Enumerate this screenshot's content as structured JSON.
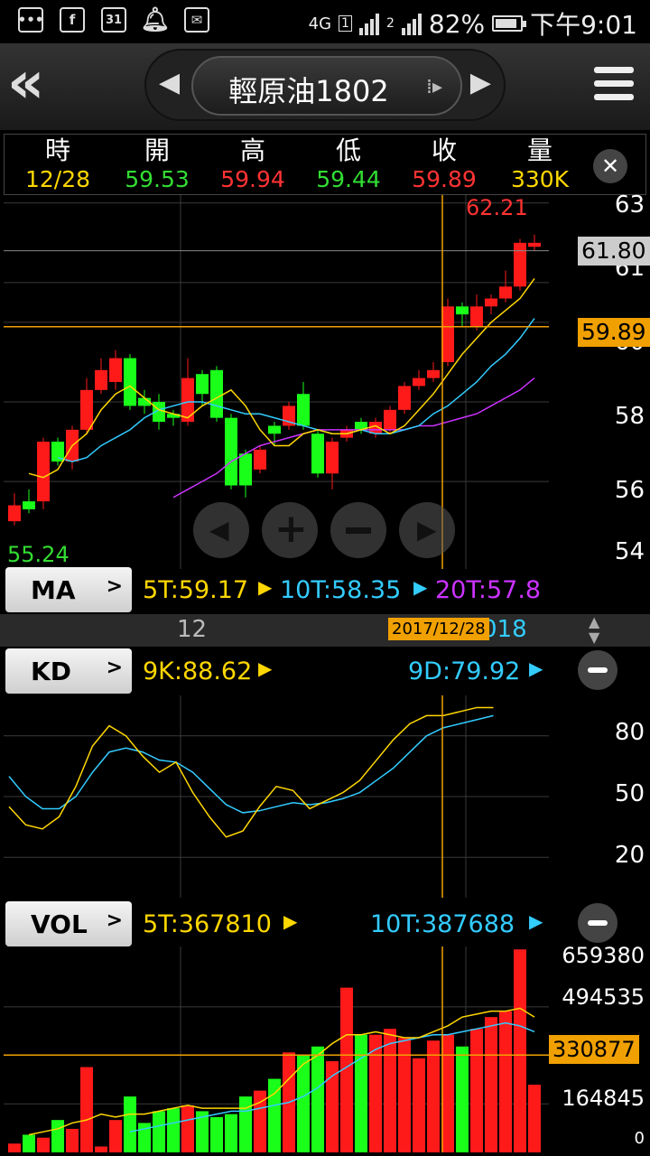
{
  "status": {
    "network": "4G",
    "sim1": "1",
    "sim2": "2",
    "battery": "82%",
    "battery_level": 0.82,
    "time": "下午9:01"
  },
  "header": {
    "title": "輕原油1802"
  },
  "quote": {
    "headers": [
      "時",
      "開",
      "高",
      "低",
      "收",
      "量"
    ],
    "values": [
      "12/28",
      "59.53",
      "59.94",
      "59.44",
      "59.89",
      "330K"
    ],
    "colors": [
      "#ffd700",
      "#33dd33",
      "#ff3333",
      "#33dd33",
      "#ff3333",
      "#ffd700"
    ]
  },
  "price_chart": {
    "y_ticks": [
      "63",
      "61",
      "60",
      "58",
      "56",
      "54"
    ],
    "high_label": "62.21",
    "low_label": "55.24",
    "last_tag": "61.80",
    "cursor_tag": "59.89"
  },
  "ma": {
    "button": "MA",
    "ma5": "5T:59.17",
    "ma10": "10T:58.35",
    "ma20": "20T:57.8"
  },
  "date_axis": {
    "label_month": "12",
    "label_year": "018",
    "cursor_date": "2017/12/28"
  },
  "kd": {
    "button": "KD",
    "k": "9K:88.62",
    "d": "9D:79.92",
    "y_ticks": [
      "80",
      "50",
      "20"
    ]
  },
  "vol": {
    "button": "VOL",
    "v5": "5T:367810",
    "v10": "10T:387688",
    "y_ticks": [
      "659380",
      "494535",
      "164845",
      "0"
    ],
    "cursor_tag": "330877"
  },
  "chart_data": {
    "type": "candlestick",
    "candles": [
      {
        "o": 55.0,
        "c": 55.4,
        "h": 55.7,
        "l": 54.9
      },
      {
        "o": 55.5,
        "c": 55.3,
        "h": 55.8,
        "l": 55.2
      },
      {
        "o": 55.5,
        "c": 57.0,
        "h": 57.1,
        "l": 55.3
      },
      {
        "o": 57.0,
        "c": 56.5,
        "h": 57.1,
        "l": 56.4
      },
      {
        "o": 56.5,
        "c": 57.3,
        "h": 57.4,
        "l": 56.3
      },
      {
        "o": 57.3,
        "c": 58.3,
        "h": 58.6,
        "l": 57.2
      },
      {
        "o": 58.3,
        "c": 58.8,
        "h": 59.1,
        "l": 58.2
      },
      {
        "o": 58.5,
        "c": 59.1,
        "h": 59.3,
        "l": 58.3
      },
      {
        "o": 59.1,
        "c": 57.9,
        "h": 59.2,
        "l": 57.8
      },
      {
        "o": 58.1,
        "c": 57.9,
        "h": 58.3,
        "l": 57.7
      },
      {
        "o": 58.0,
        "c": 57.5,
        "h": 58.2,
        "l": 57.3
      },
      {
        "o": 57.7,
        "c": 57.6,
        "h": 57.8,
        "l": 57.4
      },
      {
        "o": 57.5,
        "c": 58.6,
        "h": 59.1,
        "l": 57.4
      },
      {
        "o": 58.7,
        "c": 58.2,
        "h": 58.8,
        "l": 57.9
      },
      {
        "o": 58.8,
        "c": 57.6,
        "h": 58.9,
        "l": 57.5
      },
      {
        "o": 57.6,
        "c": 55.9,
        "h": 57.7,
        "l": 55.8
      },
      {
        "o": 56.7,
        "c": 55.9,
        "h": 56.8,
        "l": 55.6
      },
      {
        "o": 56.3,
        "c": 56.8,
        "h": 56.9,
        "l": 56.2
      },
      {
        "o": 57.4,
        "c": 57.2,
        "h": 57.5,
        "l": 56.9
      },
      {
        "o": 57.4,
        "c": 57.9,
        "h": 58.0,
        "l": 57.3
      },
      {
        "o": 58.2,
        "c": 57.4,
        "h": 58.5,
        "l": 57.3
      },
      {
        "o": 57.2,
        "c": 56.2,
        "h": 57.3,
        "l": 56.1
      },
      {
        "o": 56.2,
        "c": 57.0,
        "h": 57.1,
        "l": 55.8
      },
      {
        "o": 57.1,
        "c": 57.3,
        "h": 57.4,
        "l": 57.0
      },
      {
        "o": 57.5,
        "c": 57.3,
        "h": 57.6,
        "l": 57.2
      },
      {
        "o": 57.2,
        "c": 57.5,
        "h": 57.6,
        "l": 57.1
      },
      {
        "o": 57.3,
        "c": 57.8,
        "h": 57.9,
        "l": 57.2
      },
      {
        "o": 57.8,
        "c": 58.4,
        "h": 58.5,
        "l": 57.7
      },
      {
        "o": 58.4,
        "c": 58.6,
        "h": 58.8,
        "l": 58.3
      },
      {
        "o": 58.6,
        "c": 58.8,
        "h": 59.0,
        "l": 58.5
      },
      {
        "o": 59.0,
        "c": 60.4,
        "h": 60.6,
        "l": 58.9
      },
      {
        "o": 60.4,
        "c": 60.2,
        "h": 60.5,
        "l": 59.9
      },
      {
        "o": 59.9,
        "c": 60.4,
        "h": 60.7,
        "l": 59.8
      },
      {
        "o": 60.4,
        "c": 60.6,
        "h": 60.7,
        "l": 60.2
      },
      {
        "o": 60.6,
        "c": 60.9,
        "h": 61.3,
        "l": 60.5
      },
      {
        "o": 60.9,
        "c": 62.0,
        "h": 62.1,
        "l": 60.8
      },
      {
        "o": 61.9,
        "c": 62.0,
        "h": 62.21,
        "l": 61.8
      }
    ],
    "ma5": [
      56.2,
      56.1,
      56.3,
      56.9,
      57.2,
      57.8,
      58.2,
      58.4,
      58.1,
      57.8,
      57.7,
      57.6,
      57.9,
      58.1,
      58.3,
      57.9,
      57.3,
      56.9,
      56.9,
      57.2,
      57.3,
      57.2,
      57.2,
      57.3,
      57.4,
      57.2,
      57.4,
      57.8,
      58.2,
      58.7,
      59.2,
      59.6,
      60.0,
      60.3,
      60.6,
      61.1
    ],
    "ma10": [
      56.6,
      56.5,
      56.6,
      56.9,
      57.1,
      57.3,
      57.6,
      57.8,
      57.9,
      58.0,
      58.0,
      57.9,
      57.8,
      57.7,
      57.7,
      57.6,
      57.5,
      57.4,
      57.3,
      57.2,
      57.2,
      57.3,
      57.2,
      57.2,
      57.3,
      57.4,
      57.7,
      57.9,
      58.2,
      58.5,
      58.9,
      59.2,
      59.6,
      60.1
    ],
    "ma20": [
      55.6,
      55.8,
      56.0,
      56.2,
      56.5,
      56.7,
      56.9,
      57.0,
      57.1,
      57.2,
      57.3,
      57.3,
      57.3,
      57.3,
      57.3,
      57.3,
      57.3,
      57.4,
      57.4,
      57.5,
      57.6,
      57.7,
      57.9,
      58.1,
      58.3,
      58.6
    ],
    "kd_k": [
      45,
      36,
      34,
      40,
      55,
      75,
      85,
      80,
      70,
      62,
      67,
      52,
      40,
      30,
      33,
      45,
      55,
      53,
      44,
      48,
      52,
      58,
      68,
      78,
      86,
      90,
      90,
      92,
      94,
      94
    ],
    "kd_d": [
      60,
      50,
      44,
      44,
      50,
      62,
      72,
      74,
      72,
      68,
      67,
      62,
      54,
      46,
      42,
      43,
      45,
      47,
      46,
      47,
      49,
      52,
      58,
      64,
      72,
      80,
      84,
      86,
      88,
      90
    ],
    "volume": [
      30000,
      60000,
      50000,
      110000,
      80000,
      290000,
      20000,
      110000,
      190000,
      100000,
      140000,
      150000,
      160000,
      140000,
      120000,
      130000,
      190000,
      210000,
      250000,
      340000,
      330000,
      360000,
      310000,
      560000,
      400000,
      400000,
      420000,
      390000,
      320000,
      380000,
      400000,
      360000,
      420000,
      460000,
      480000,
      690000,
      230000
    ],
    "vol_ma5": [
      60000,
      70000,
      80000,
      100000,
      110000,
      130000,
      120000,
      130000,
      130000,
      140000,
      150000,
      160000,
      150000,
      150000,
      150000,
      150000,
      170000,
      200000,
      250000,
      300000,
      330000,
      370000,
      400000,
      400000,
      410000,
      400000,
      390000,
      390000,
      410000,
      430000,
      460000,
      470000,
      480000,
      480000,
      490000,
      460000
    ],
    "vol_ma10": [
      70000,
      80000,
      90000,
      100000,
      110000,
      120000,
      130000,
      140000,
      140000,
      150000,
      160000,
      170000,
      190000,
      220000,
      260000,
      290000,
      320000,
      350000,
      370000,
      380000,
      390000,
      400000,
      400000,
      410000,
      420000,
      430000,
      440000,
      430000,
      410000
    ]
  }
}
